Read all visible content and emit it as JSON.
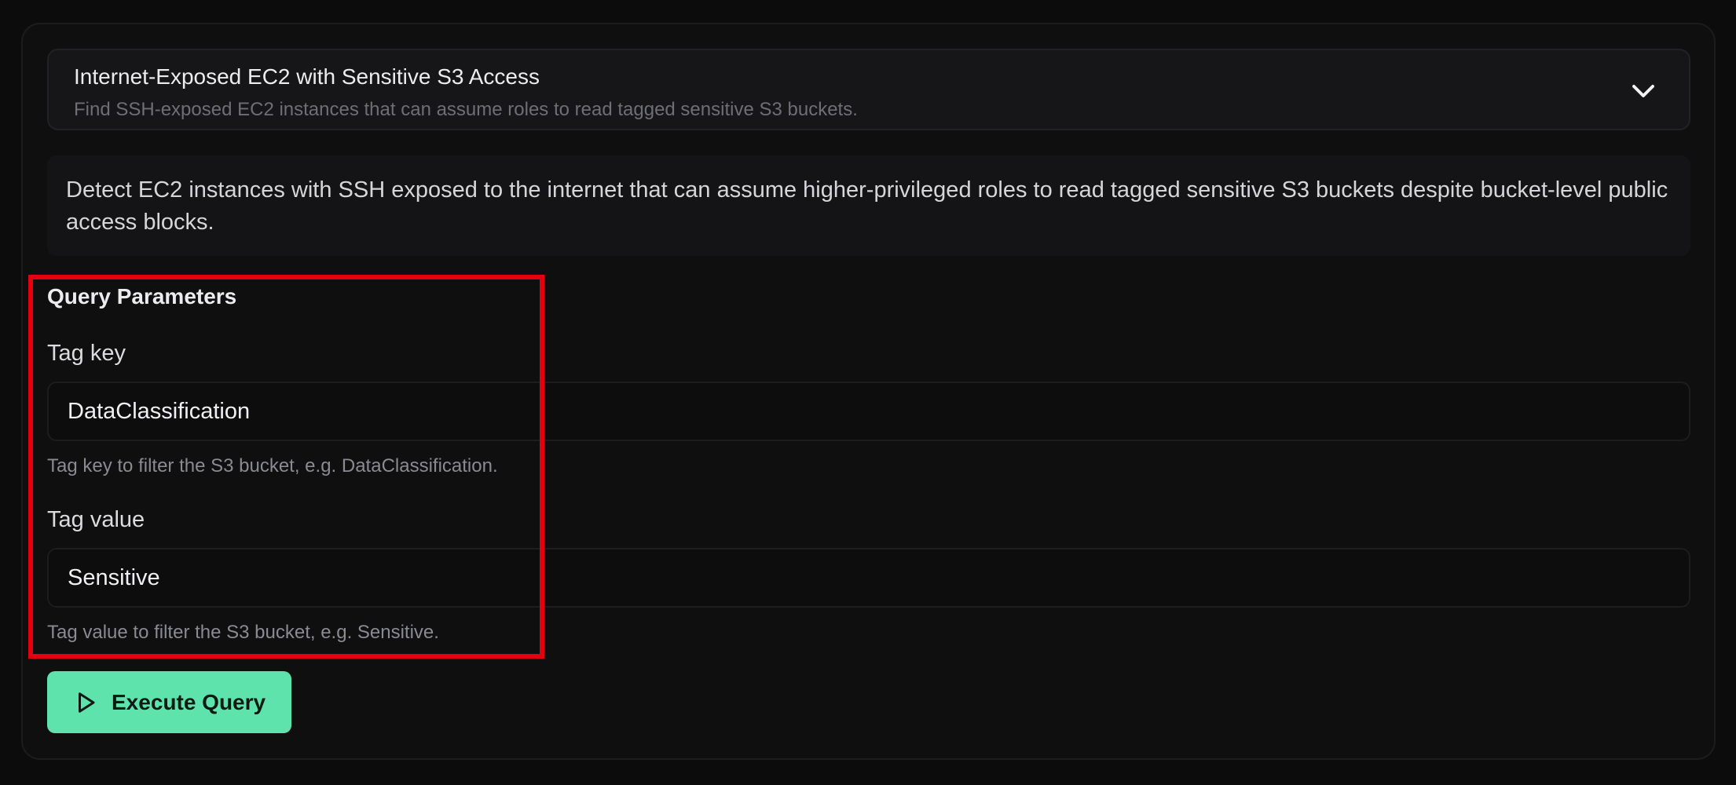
{
  "query": {
    "title": "Internet-Exposed EC2 with Sensitive S3 Access",
    "subtitle": "Find SSH-exposed EC2 instances that can assume roles to read tagged sensitive S3 buckets.",
    "expand_icon": "chevron-down-icon"
  },
  "description": "Detect EC2 instances with SSH exposed to the internet that can assume higher-privileged roles to read tagged sensitive S3 buckets despite bucket-level public access blocks.",
  "parameters": {
    "section_title": "Query Parameters",
    "tag_key": {
      "label": "Tag key",
      "value": "DataClassification",
      "help": "Tag key to filter the S3 bucket, e.g. DataClassification."
    },
    "tag_value": {
      "label": "Tag value",
      "value": "Sensitive",
      "help": "Tag value to filter the S3 bucket, e.g. Sensitive."
    }
  },
  "actions": {
    "execute_label": "Execute Query",
    "execute_icon": "play-icon"
  },
  "colors": {
    "accent": "#5ee3ad",
    "highlight": "#e4000f",
    "background": "#0c0c0d"
  }
}
